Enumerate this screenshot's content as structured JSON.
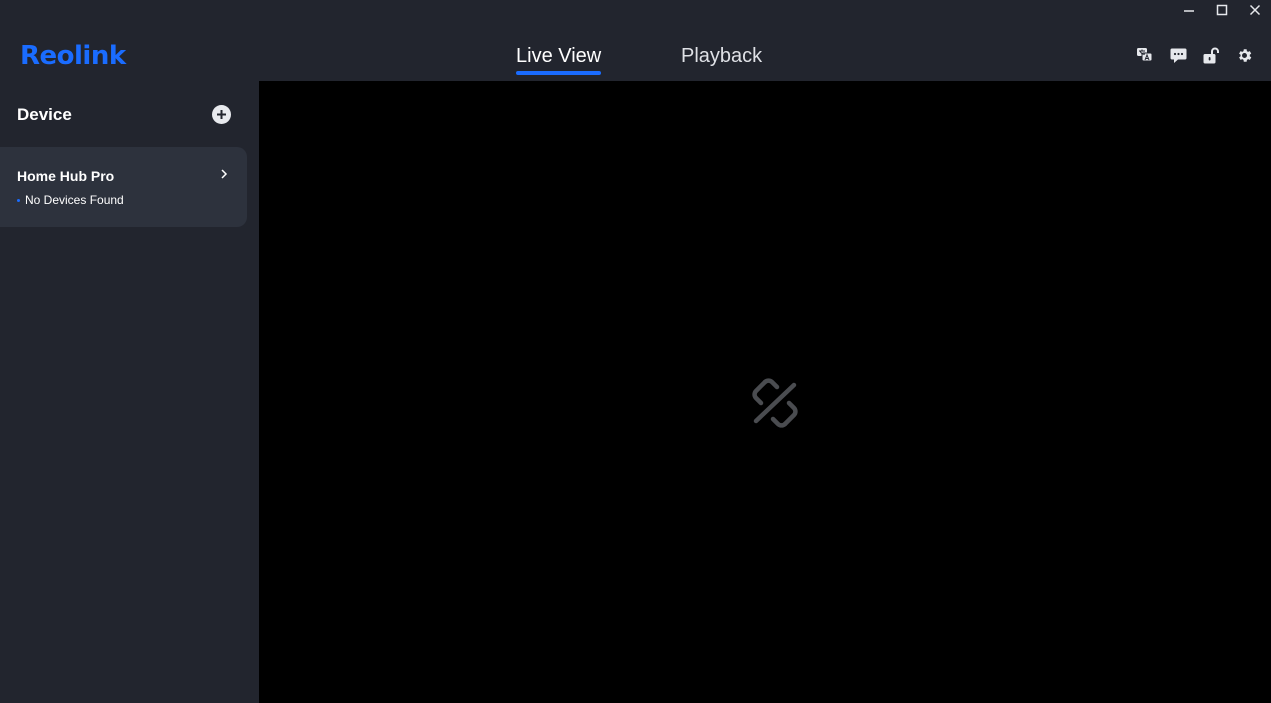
{
  "window": {
    "controls": [
      "minimize-icon",
      "maximize-icon",
      "close-icon"
    ]
  },
  "header": {
    "logo_text": "Reolink",
    "tabs": [
      {
        "label": "Live View",
        "active": true
      },
      {
        "label": "Playback",
        "active": false
      }
    ],
    "icons": [
      "language-icon",
      "message-icon",
      "unlock-icon",
      "gear-icon"
    ]
  },
  "sidebar": {
    "title": "Device",
    "devices": [
      {
        "name": "Home Hub Pro",
        "status": "No Devices Found"
      }
    ]
  },
  "viewport": {
    "icon": "broken-link-icon"
  },
  "colors": {
    "accent": "#1a6cff",
    "background": "#22252e",
    "card": "#2d323d",
    "viewport": "#000000"
  }
}
